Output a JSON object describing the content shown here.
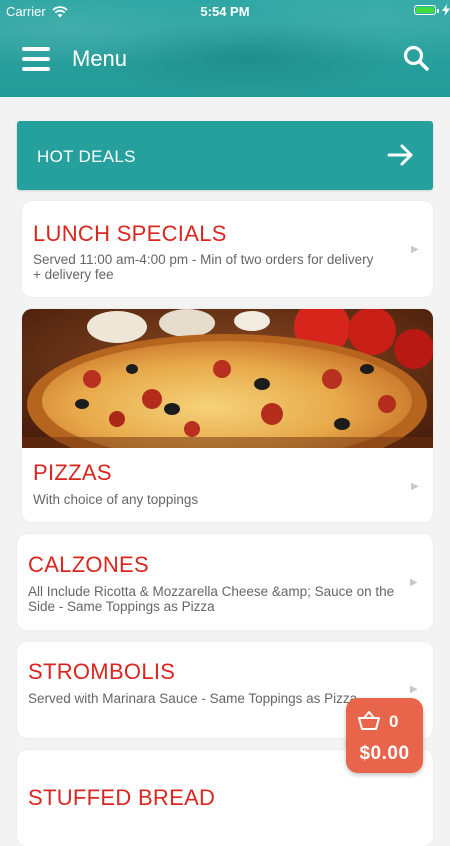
{
  "status_bar": {
    "carrier": "Carrier",
    "time": "5:54 PM"
  },
  "header": {
    "title": "Menu"
  },
  "hot_deals": {
    "label": "HOT DEALS"
  },
  "categories": [
    {
      "title": "LUNCH SPECIALS",
      "description": "Served 11:00 am-4:00 pm - Min of two orders for delivery + delivery fee"
    },
    {
      "title": "PIZZAS",
      "description": "With choice of any toppings"
    },
    {
      "title": "CALZONES",
      "description": "All Include Ricotta & Mozzarella Cheese &amp; Sauce on the Side - Same Toppings as Pizza"
    },
    {
      "title": "STROMBOLIS",
      "description": "Served with Marinara Sauce - Same Toppings as Pizza"
    },
    {
      "title": "STUFFED BREAD",
      "description": ""
    }
  ],
  "cart": {
    "count": "0",
    "total": "$0.00"
  },
  "colors": {
    "header_teal": "#2ba6a3",
    "hot_deals_teal": "#26a09d",
    "title_red": "#d9261f",
    "cart_orange": "#e8644a"
  },
  "icons": [
    "wifi-icon",
    "battery-icon",
    "charge-icon",
    "hamburger-icon",
    "search-icon",
    "arrow-right-icon",
    "chevron-right-icon",
    "basket-icon"
  ]
}
